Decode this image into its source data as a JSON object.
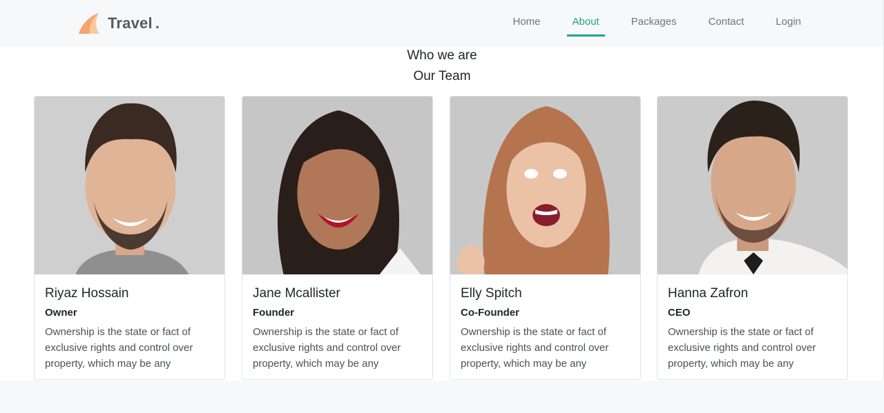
{
  "brand": {
    "name": "Travel",
    "dot": ".",
    "logo_icon": "sail-logo-icon",
    "logo_color": "#f4a46c"
  },
  "nav": {
    "items": [
      {
        "label": "Home",
        "active": false
      },
      {
        "label": "About",
        "active": true
      },
      {
        "label": "Packages",
        "active": false
      },
      {
        "label": "Contact",
        "active": false
      },
      {
        "label": "Login",
        "active": false
      }
    ],
    "active_color": "#1ea489"
  },
  "section": {
    "title": "Who we are",
    "subtitle": "Our Team"
  },
  "team": [
    {
      "name": "Riyaz Hossain",
      "role": "Owner",
      "description": "Ownership is the state or fact of exclusive rights and control over property, which may be any"
    },
    {
      "name": "Jane Mcallister",
      "role": "Founder",
      "description": "Ownership is the state or fact of exclusive rights and control over property, which may be any"
    },
    {
      "name": "Elly Spitch",
      "role": "Co-Founder",
      "description": "Ownership is the state or fact of exclusive rights and control over property, which may be any"
    },
    {
      "name": "Hanna Zafron",
      "role": "CEO",
      "description": "Ownership is the state or fact of exclusive rights and control over property, which may be any"
    }
  ]
}
